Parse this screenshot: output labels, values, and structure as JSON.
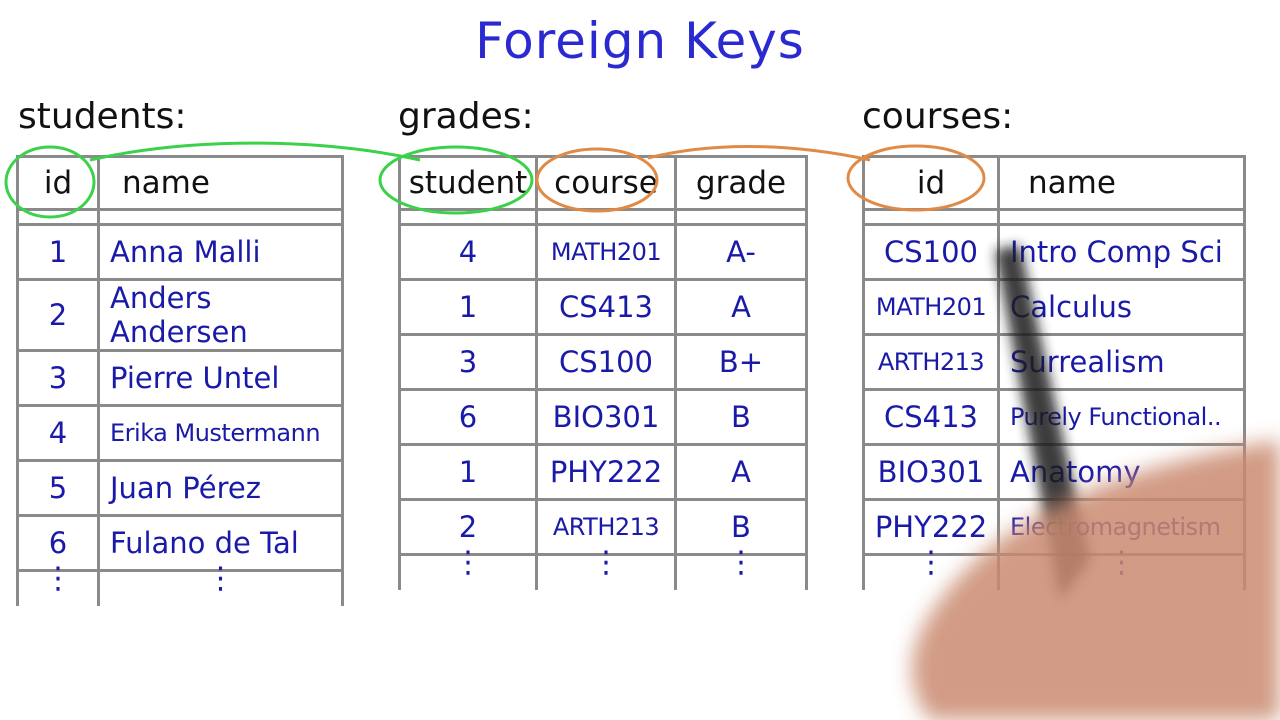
{
  "title": "Foreign Keys",
  "colors": {
    "pen_blue": "#1a1aa8",
    "green_circle": "#3bd14a",
    "orange_circle": "#e08a45",
    "grid": "#8a8a8a"
  },
  "students": {
    "label": "students:",
    "headers": [
      "id",
      "name"
    ],
    "rows": [
      {
        "id": "1",
        "name": "Anna Malli"
      },
      {
        "id": "2",
        "name": "Anders Andersen"
      },
      {
        "id": "3",
        "name": "Pierre Untel"
      },
      {
        "id": "4",
        "name": "Erika Mustermann"
      },
      {
        "id": "5",
        "name": "Juan Pérez"
      },
      {
        "id": "6",
        "name": "Fulano de Tal"
      }
    ],
    "continuation": "⋮"
  },
  "grades": {
    "label": "grades:",
    "headers": [
      "student",
      "course",
      "grade"
    ],
    "rows": [
      {
        "student": "4",
        "course": "MATH201",
        "grade": "A-"
      },
      {
        "student": "1",
        "course": "CS413",
        "grade": "A"
      },
      {
        "student": "3",
        "course": "CS100",
        "grade": "B+"
      },
      {
        "student": "6",
        "course": "BIO301",
        "grade": "B"
      },
      {
        "student": "1",
        "course": "PHY222",
        "grade": "A"
      },
      {
        "student": "2",
        "course": "ARTH213",
        "grade": "B"
      }
    ],
    "continuation": "⋮"
  },
  "courses": {
    "label": "courses:",
    "headers": [
      "id",
      "name"
    ],
    "rows": [
      {
        "id": "CS100",
        "name": "Intro Comp Sci"
      },
      {
        "id": "MATH201",
        "name": "Calculus"
      },
      {
        "id": "ARTH213",
        "name": "Surrealism"
      },
      {
        "id": "CS413",
        "name": "Purely Functional.."
      },
      {
        "id": "BIO301",
        "name": "Anatomy"
      },
      {
        "id": "PHY222",
        "name": "Electromagnetism"
      }
    ],
    "continuation": "⋮"
  },
  "annotations": [
    {
      "type": "foreign-key-link",
      "color": "green",
      "from": "students.id",
      "to": "grades.student"
    },
    {
      "type": "foreign-key-link",
      "color": "orange",
      "from": "grades.course",
      "to": "courses.id"
    }
  ]
}
